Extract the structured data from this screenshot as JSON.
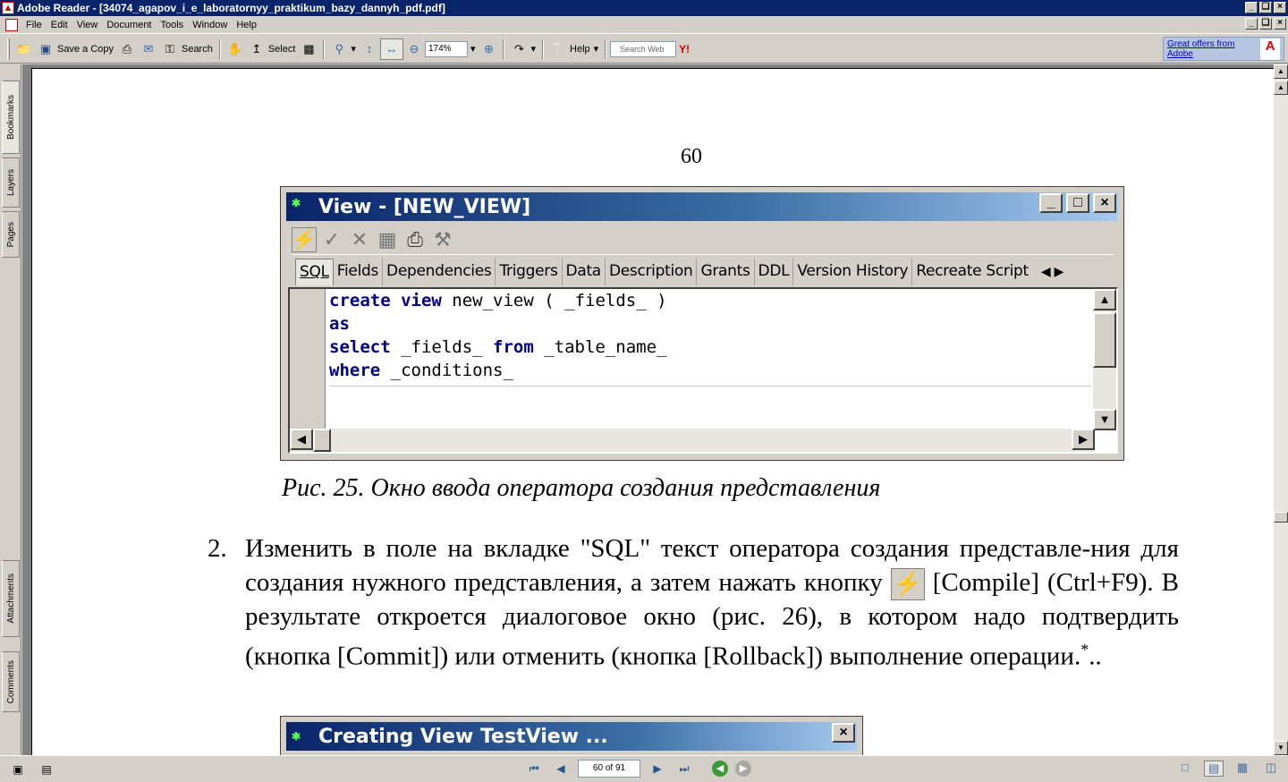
{
  "window": {
    "title": "Adobe Reader - [34074_agapov_i_e_laboratornyy_praktikum_bazy_dannyh_pdf.pdf]"
  },
  "menu": [
    "File",
    "Edit",
    "View",
    "Document",
    "Tools",
    "Window",
    "Help"
  ],
  "toolbar": {
    "save_copy": "Save a Copy",
    "search": "Search",
    "select": "Select",
    "zoom": "174%",
    "help": "Help",
    "search_web_placeholder": "Search Web",
    "yahoo": "Y!"
  },
  "ad": {
    "text": "Great offers from Adobe",
    "logo": "A"
  },
  "nav_tabs": [
    "Bookmarks",
    "Layers",
    "Pages",
    "Attachments",
    "Comments"
  ],
  "page": {
    "number": "60",
    "dialog": {
      "title": "View - [NEW_VIEW]",
      "tabs": [
        "SQL",
        "Fields",
        "Dependencies",
        "Triggers",
        "Data",
        "Description",
        "Grants",
        "DDL",
        "Version History",
        "Recreate Script"
      ],
      "code": {
        "l1_kw1": "create",
        "l1_kw2": "view",
        "l1_rest": " new_view ( _fields_ )",
        "l2_kw": "as",
        "l3_kw1": "select",
        "l3_mid": " _fields_ ",
        "l3_kw2": "from",
        "l3_rest": " _table_name_",
        "l4_kw": "where",
        "l4_rest": " _conditions_"
      }
    },
    "caption": "Рис. 25. Окно ввода оператора создания представления",
    "item_number": "2.",
    "para_part1": "Изменить в поле на вкладке \"SQL\" текст оператора создания представле-ния для создания нужного представления, а затем нажать кнопку",
    "para_part2": "[Compile] (Ctrl+F9). В результате откроется диалоговое окно (рис. 26), в котором надо подтвердить (кнопка [Commit]) или отменить (кнопка [Rollback]) выполнение операции.",
    "footnote_mark": "*",
    "dialog2_title": "Creating View TestView ..."
  },
  "status": {
    "page_indicator": "60 of 91"
  }
}
